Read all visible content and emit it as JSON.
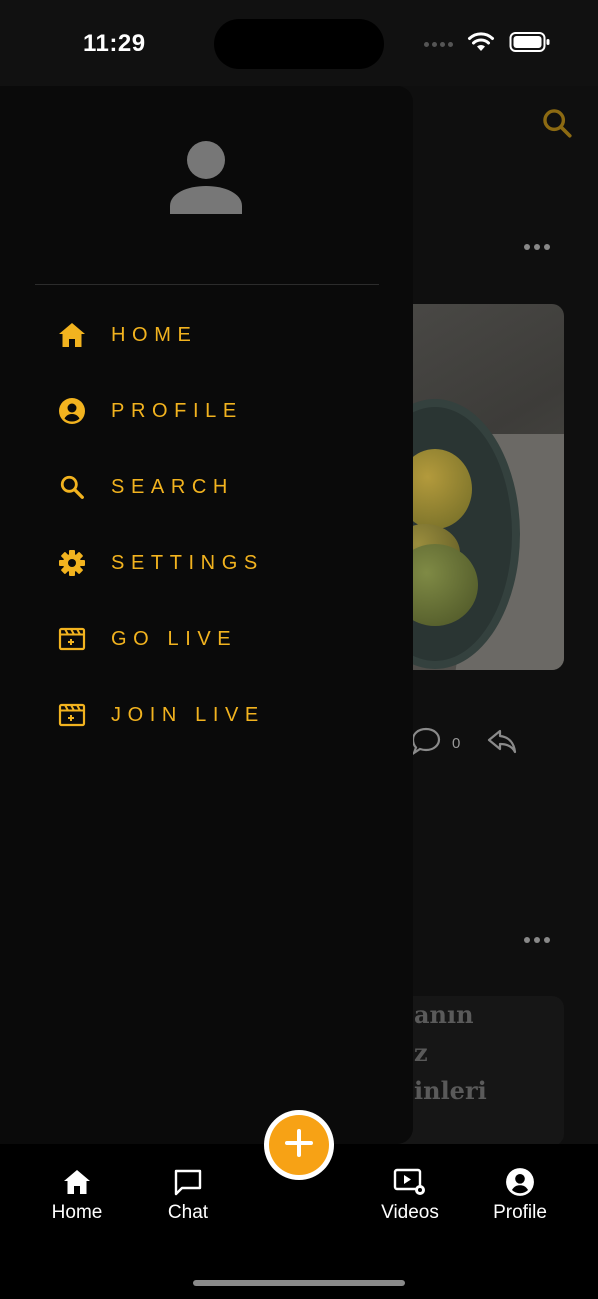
{
  "status_bar": {
    "time": "11:29"
  },
  "colors": {
    "accent": "#f2b31f",
    "fab": "#f7a215",
    "drawer_bg": "#0a0a0a",
    "nav_bg": "#000000"
  },
  "feed": {
    "comment_count": "0",
    "post_text_lines": [
      "anın",
      "z",
      "inleri"
    ]
  },
  "drawer": {
    "avatar_icon": "person-icon",
    "menu": [
      {
        "label": "HOME",
        "icon": "home-icon"
      },
      {
        "label": "PROFILE",
        "icon": "account-circle-icon"
      },
      {
        "label": "SEARCH",
        "icon": "search-icon"
      },
      {
        "label": "SETTINGS",
        "icon": "gear-icon"
      },
      {
        "label": "GO LIVE",
        "icon": "live-clapper-icon"
      },
      {
        "label": "JOIN LIVE",
        "icon": "live-clapper-icon"
      }
    ]
  },
  "fab": {
    "icon": "plus-icon"
  },
  "bottom_nav": {
    "items": [
      {
        "label": "Home",
        "icon": "home-icon"
      },
      {
        "label": "Chat",
        "icon": "chat-bubble-icon"
      },
      {
        "label": "Videos",
        "icon": "video-settings-icon"
      },
      {
        "label": "Profile",
        "icon": "account-circle-icon"
      }
    ]
  }
}
